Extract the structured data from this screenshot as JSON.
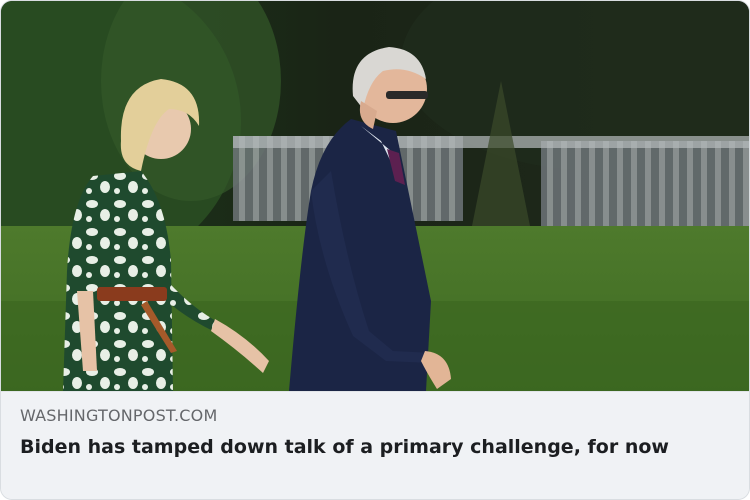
{
  "link_preview": {
    "image_alt": "Two people walking on a lawn",
    "domain": "WASHINGTONPOST.COM",
    "headline": "Biden has tamped down talk of a primary challenge, for now"
  }
}
